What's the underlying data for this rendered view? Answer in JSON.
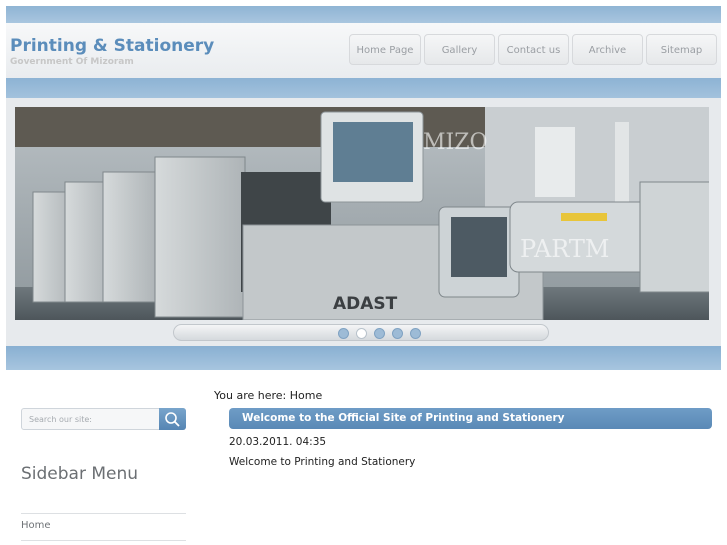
{
  "header": {
    "title": "Printing & Stationery",
    "subtitle": "Government Of Mizoram"
  },
  "nav": {
    "items": [
      "Home Page",
      "Gallery",
      "Contact us",
      "Archive",
      "Sitemap"
    ]
  },
  "slider": {
    "overlay_words": [
      "MIZO",
      "PARTM"
    ],
    "machine_brand": "ADAST",
    "dot_count": 5,
    "active_dot": 2
  },
  "search": {
    "placeholder": "Search our site:"
  },
  "sidebar": {
    "title": "Sidebar Menu",
    "items": [
      {
        "label": "Home"
      }
    ]
  },
  "breadcrumb": "You are here: Home",
  "main": {
    "heading": "Welcome to the Official Site of Printing and Stationery",
    "date": "20.03.2011. 04:35",
    "body": "Welcome to Printing and Stationery"
  },
  "colors": {
    "accent": "#5b8dbb",
    "band": "#9bbcda",
    "heading_bar": "#6592bf"
  }
}
